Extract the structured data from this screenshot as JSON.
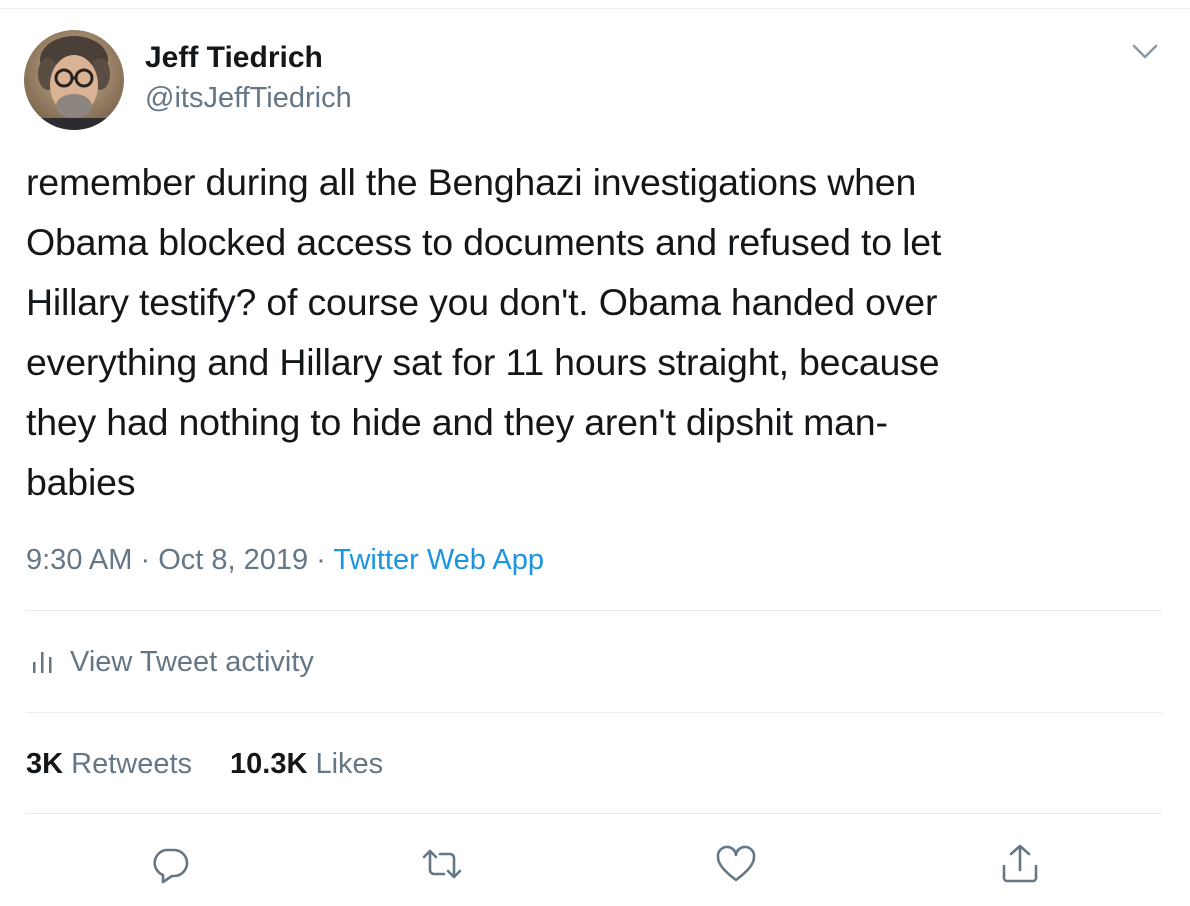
{
  "author": {
    "name": "Jeff Tiedrich",
    "handle": "@itsJeffTiedrich"
  },
  "tweet": {
    "lines": [
      "remember during all the Benghazi investigations when",
      "Obama blocked access to documents and refused to let",
      "Hillary testify? of course you don't. Obama handed over",
      "everything and Hillary sat for 11 hours straight, because",
      "they had nothing to hide and they aren't dipshit man-",
      "babies"
    ]
  },
  "meta": {
    "time": "9:30 AM",
    "separator": " · ",
    "date": "Oct 8, 2019",
    "source": "Twitter Web App"
  },
  "activity": {
    "label": "View Tweet activity",
    "icon": "bar-chart-icon"
  },
  "stats": {
    "retweets_count": "3K",
    "retweets_label": "Retweets",
    "likes_count": "10.3K",
    "likes_label": "Likes"
  },
  "actions": {
    "icons": [
      "reply-icon",
      "retweet-icon",
      "like-icon",
      "share-icon"
    ]
  },
  "colors": {
    "text": "#14171a",
    "secondary": "#657786",
    "link": "#1b95e0",
    "divider": "#e6ecf0"
  }
}
